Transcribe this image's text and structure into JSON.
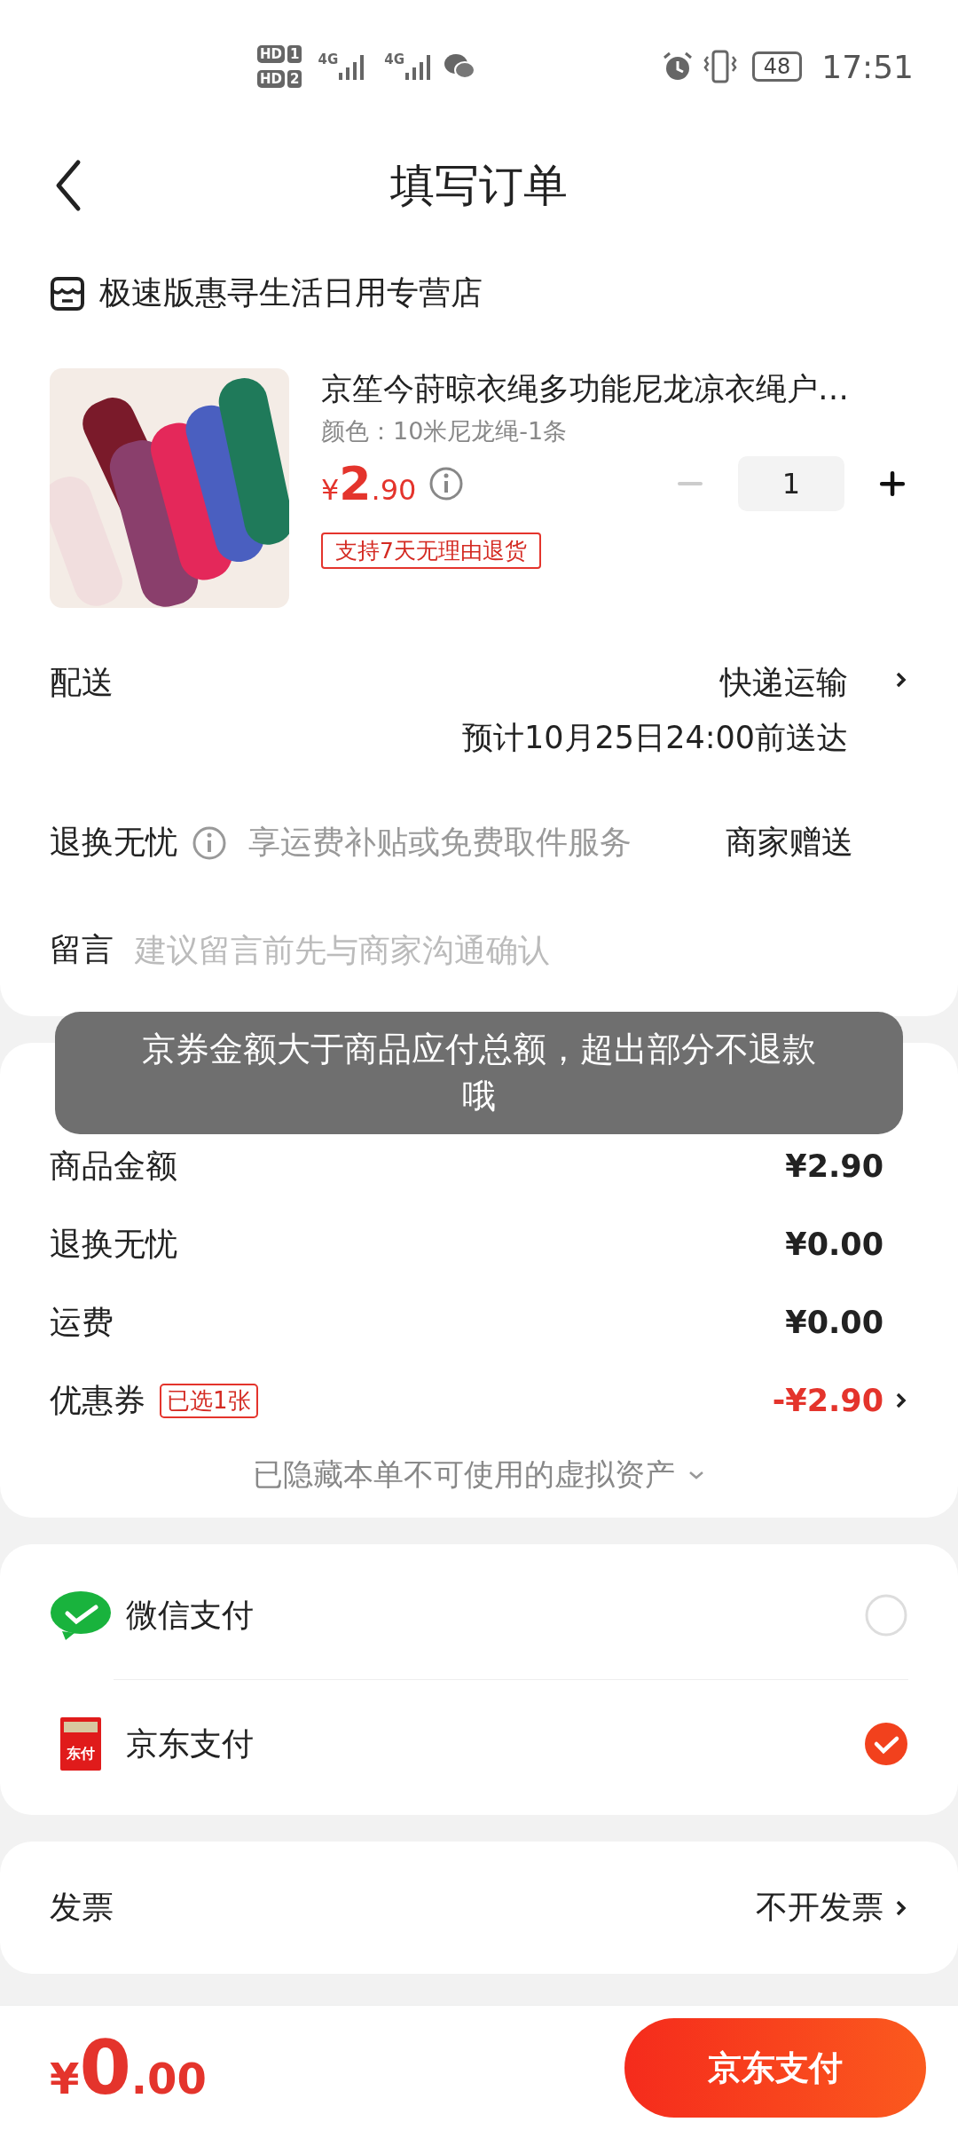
{
  "status_bar": {
    "sims": [
      {
        "label": "HD",
        "slot": "1"
      },
      {
        "label": "HD",
        "slot": "2"
      }
    ],
    "networks": [
      "4G",
      "4G"
    ],
    "battery": "48",
    "time": "17:51"
  },
  "header": {
    "title": "填写订单"
  },
  "store": {
    "name": "极速版惠寻生活日用专营店"
  },
  "product": {
    "title": "京笙今莳晾衣绳多功能尼龙凉衣绳户…",
    "variant": "颜色：10米尼龙绳-1条",
    "price": {
      "currency": "¥",
      "integer": "2",
      "decimal": ".90"
    },
    "quantity": "1",
    "tag": "支持7天无理由退货"
  },
  "delivery": {
    "label": "配送",
    "method": "快递运输",
    "eta": "预计10月25日24:00前送达"
  },
  "returns": {
    "label": "退换无忧",
    "description": "享运费补贴或免费取件服务",
    "value": "商家赠送"
  },
  "message": {
    "label": "留言",
    "placeholder": "建议留言前先与商家沟通确认"
  },
  "toast": {
    "text": "京券金额大于商品应付总额，超出部分不退款哦"
  },
  "summary": [
    {
      "kind": "plain",
      "label": "商品金额",
      "value": "¥2.90"
    },
    {
      "kind": "plain",
      "label": "退换无忧",
      "value": "¥0.00"
    },
    {
      "kind": "plain",
      "label": "运费",
      "value": "¥0.00"
    },
    {
      "kind": "coupon",
      "label": "优惠券",
      "badge": "已选1张",
      "value": "-¥2.90"
    }
  ],
  "hidden_assets": "已隐藏本单不可使用的虚拟资产",
  "payments": [
    {
      "kind": "wechat",
      "label": "微信支付",
      "selected": false
    },
    {
      "kind": "jd",
      "label": "京东支付",
      "selected": true,
      "icon_text": "东付"
    }
  ],
  "invoice": {
    "label": "发票",
    "value": "不开发票"
  },
  "footer": {
    "total": {
      "currency": "¥",
      "integer": "0",
      "decimal": ".00"
    },
    "button": "京东支付"
  }
}
